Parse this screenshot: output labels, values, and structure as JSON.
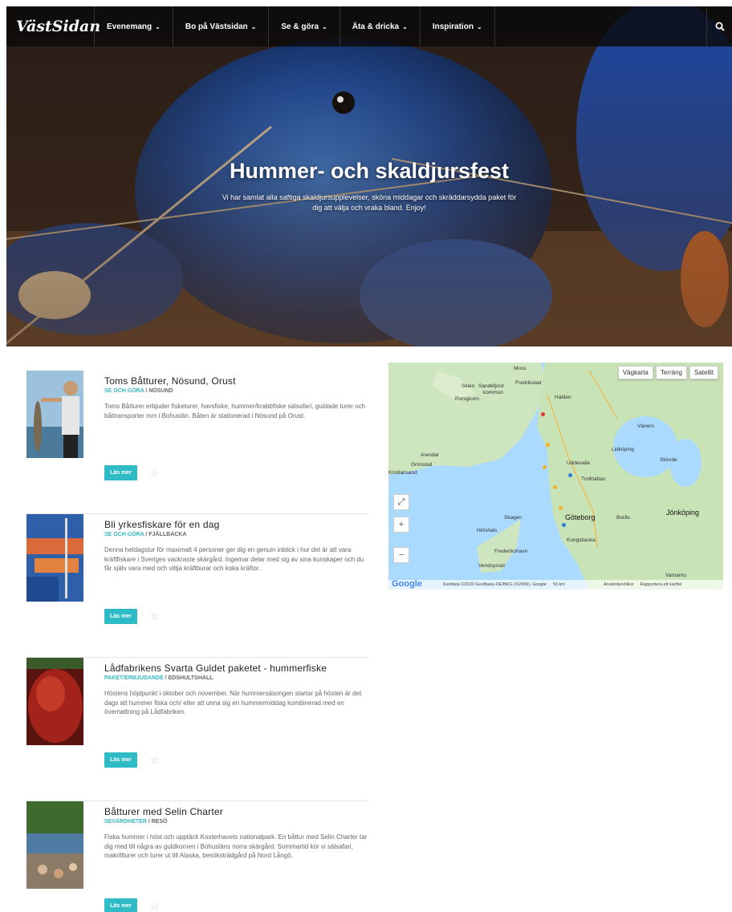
{
  "header": {
    "logo": "VästSidan",
    "nav": [
      {
        "label": "Evenemang"
      },
      {
        "label": "Bo på Västsidan"
      },
      {
        "label": "Se & göra"
      },
      {
        "label": "Äta & dricka"
      },
      {
        "label": "Inspiration"
      }
    ],
    "chevron": "⌄",
    "search_icon": "search-icon"
  },
  "hero": {
    "title": "Hummer- och skaldjursfest",
    "subtitle": "Vi har samlat alla saftiga skaldjursupplevelser, sköna middagar och skräddarsydda paket för dig att välja och vraka bland. Enjoy!"
  },
  "items": [
    {
      "title": "Toms Båtturer, Nösund, Orust",
      "category": "SE OCH GÖRA",
      "place": "NÖSUND",
      "description": "Toms Båtturer erbjuder fisketurer, havsfiske, hummer/krabbfiske sälsafari, guidade turer och båttransporter mm i Bohuslän. Båten är stationerad i Nösund på Orust.",
      "button": "Läs mer"
    },
    {
      "title": "Bli yrkesfiskare för en dag",
      "category": "SE OCH GÖRA",
      "place": "FJÄLLBACKA",
      "description": "Denna heldagstur för maximalt 4 personer ger dig en genuin inblick i hur det är att vara kräftfiskare i Sveriges vackraste skärgård. Ingemar delar med sig av sina kunskaper och du får själv vara med och vittja kräftburar och koka kräftor.",
      "button": "Läs mer"
    },
    {
      "title": "Lådfabrikens Svarta Guldet paketet - hummerfiske",
      "category": "PAKET/ERBJUDANDE",
      "place": "EDSHULTSHALL",
      "description": "Höstens höjdpunkt i oktober och november. När hummersäsongen startar på hösten är det dags att hummer fiska och/ eller att unna sig en hummermiddag kombinerad med en övernattning på Lådfabriken.",
      "button": "Läs mer"
    },
    {
      "title": "Båtturer med Selin Charter",
      "category": "SEVÄRDHETER",
      "place": "RESÖ",
      "description": "Fiska hummer i höst och upptäck Kosterhavets nationalpark. En båttur med Selin Charter tar dig med till några av guldkornen i Bohusläns norra skärgård. Sommartid kör vi sälsafari, makrillturer och turer ut till Alaska, besöksträdgård på Nord Långö.",
      "button": "Läs mer"
    }
  ],
  "star_icon": "☆",
  "map": {
    "buttons": [
      "Vägkarta",
      "Terräng",
      "Satellit"
    ],
    "fullscreen": "⤢",
    "zoom_in": "+",
    "zoom_out": "−",
    "labels": [
      "Skien",
      "Sandefjord",
      "kommun",
      "Porsgrunn",
      "Fredrikstad",
      "Halden",
      "Moss",
      "Arendal",
      "Grimstad",
      "Kristiansand",
      "Vänern",
      "Lidköping",
      "Skövde",
      "Uddevalla",
      "Trollhättan",
      "Göteborg",
      "Borås",
      "Jönköping",
      "Skagen",
      "Hirtshals",
      "Frederikshavn",
      "Vendsyssel",
      "Kungsbacka",
      "Varnamo"
    ],
    "google": "Google",
    "footer": [
      "Kartdata ©2020 GeoBasis-DE/BKG (©2009), Google",
      "50 km",
      "Användarvillkor",
      "Rapportera ett kartfel"
    ]
  },
  "colors": {
    "accent": "#2ebbc6",
    "category": "#38b6c4",
    "nav_bg": "#0a0a0a"
  }
}
